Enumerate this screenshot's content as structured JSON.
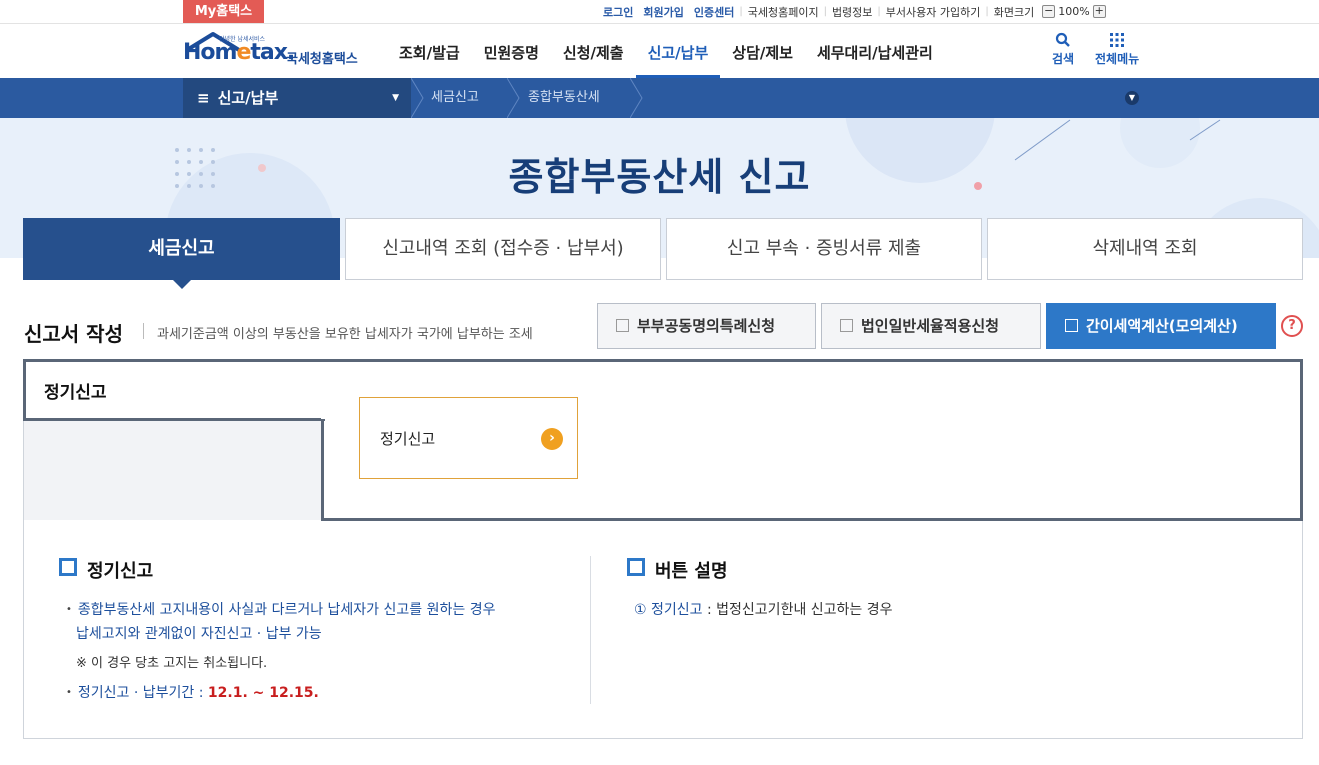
{
  "topbar": {
    "my_home": "My홈택스",
    "links": [
      "로그인",
      "회원가입",
      "인증센터",
      "국세청홈페이지",
      "법령정보",
      "부서사용자 가입하기",
      "화면크기"
    ],
    "zoom_minus": "−",
    "zoom_value": "100%",
    "zoom_plus": "+"
  },
  "header": {
    "logo_tiny": "안녕한 납세서비스",
    "logo_word_a": "Hom",
    "logo_word_e": "e",
    "logo_word_b": "tax.",
    "logo_kr": "국세청홈택스",
    "menu": [
      "조회/발급",
      "민원증명",
      "신청/제출",
      "신고/납부",
      "상담/제보",
      "세무대리/납세관리"
    ],
    "search_label": "검색",
    "allmenu_label": "전체메뉴"
  },
  "location": {
    "current_menu": "신고/납부",
    "crumbs": [
      "세금신고",
      "종합부동산세"
    ]
  },
  "hero": {
    "title": "종합부동산세  신고"
  },
  "tabs": [
    "세금신고",
    "신고내역 조회 (접수증 · 납부서)",
    "신고 부속 · 증빙서류 제출",
    "삭제내역 조회"
  ],
  "section": {
    "title": "신고서 작성",
    "description": "과세기준금액 이상의 부동산을 보유한 납세자가 국가에 납부하는 조세",
    "buttons": [
      "부부공동명의특례신청",
      "법인일반세율적용신청",
      "간이세액계산(모의계산)"
    ],
    "help": "?"
  },
  "report": {
    "left_label": "정기신고",
    "card_label": "정기신고",
    "card_arrow": "›"
  },
  "info_left": {
    "heading": "정기신고",
    "line1": "종합부동산세 고지내용이 사실과 다르거나 납세자가 신고를 원하는 경우",
    "line2": "납세고지와 관계없이 자진신고 · 납부 가능",
    "note": "※ 이 경우 당초 고지는 취소됩니다.",
    "period_label": "정기신고 · 납부기간 :",
    "period_value": "12.1. ~ 12.15."
  },
  "info_right": {
    "heading": "버튼 설명",
    "item_num": "①",
    "item_name": "정기신고",
    "item_desc": ": 법정신고기한내 신고하는 경우"
  },
  "colors": {
    "brand_blue": "#1f5eb8",
    "nav_dark": "#2b5aa0",
    "tab_active": "#26508d",
    "accent_orange": "#f0a020",
    "period_red": "#c81e1e"
  }
}
